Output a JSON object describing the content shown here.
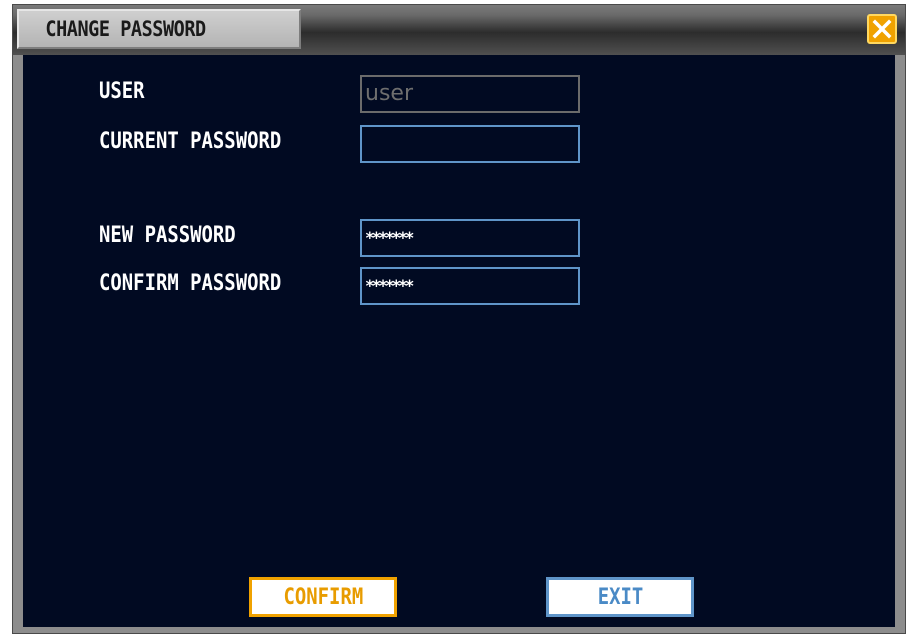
{
  "dialog": {
    "title": "CHANGE PASSWORD",
    "close_icon": "close-x-icon",
    "accent_color": "#f0a200",
    "field_border_color": "#5f95c9",
    "background_color": "#010a22"
  },
  "form": {
    "user_label": "USER",
    "user_value": "user",
    "current_password_label": "CURRENT PASSWORD",
    "current_password_value": "",
    "new_password_label": "NEW PASSWORD",
    "new_password_value": "*******",
    "confirm_password_label": "CONFIRM PASSWORD",
    "confirm_password_value": "*******"
  },
  "buttons": {
    "confirm_label": "CONFIRM",
    "exit_label": "EXIT"
  }
}
